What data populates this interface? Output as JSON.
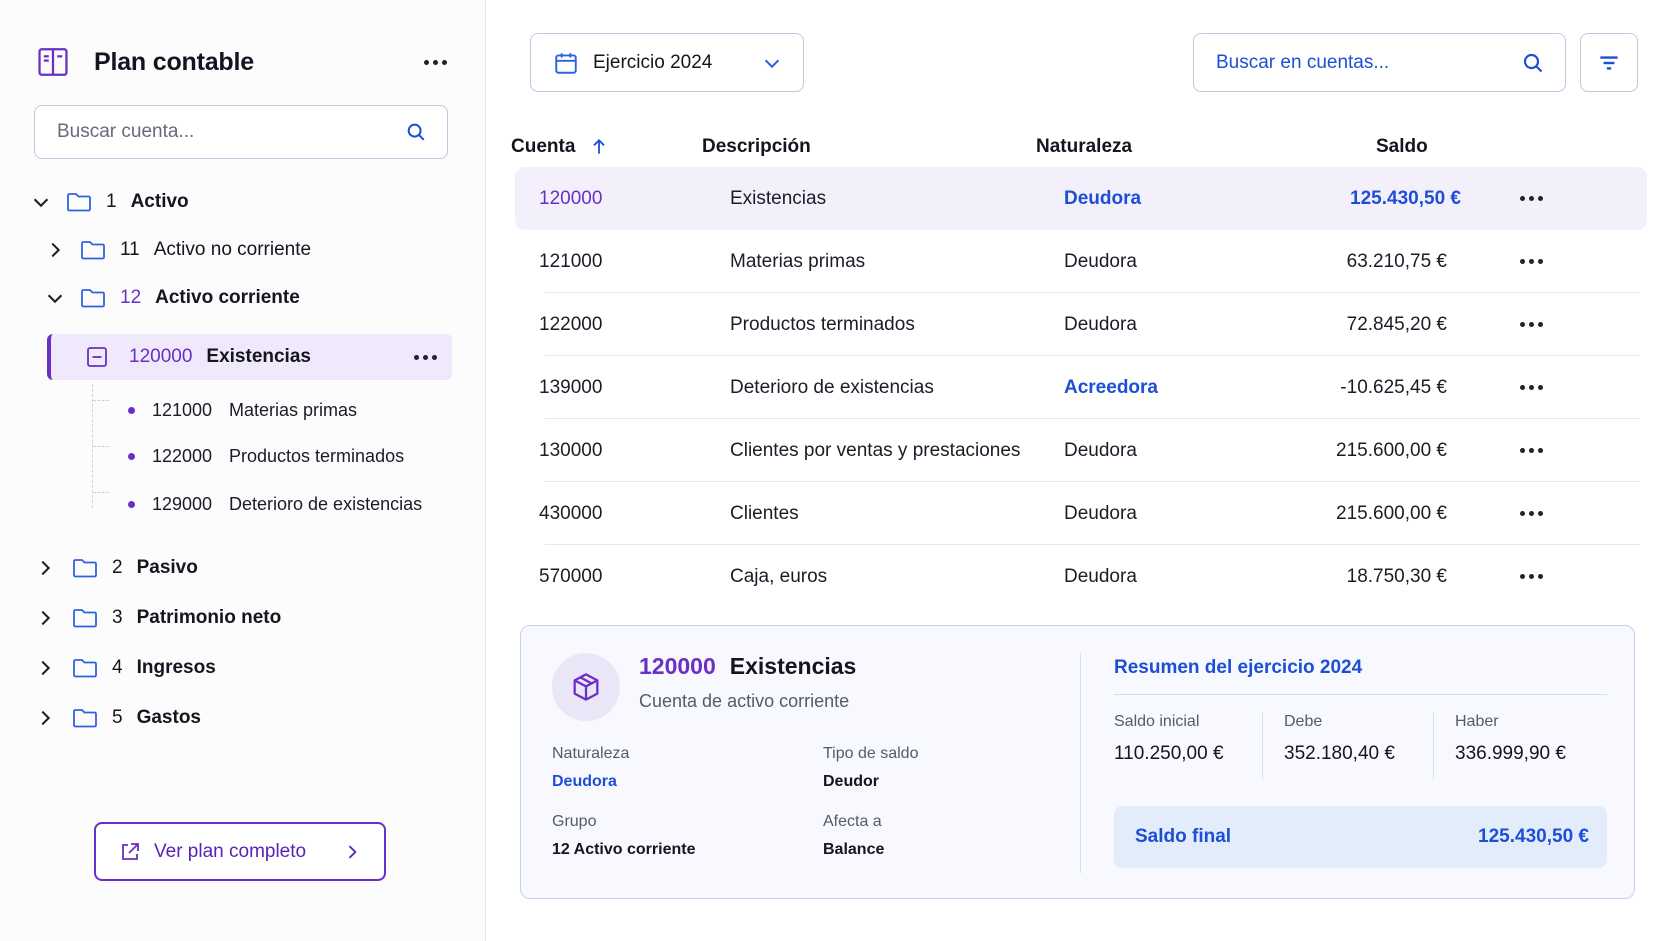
{
  "sidebar": {
    "title": "Plan contable",
    "search_placeholder": "Buscar cuenta...",
    "tree": [
      {
        "code": "1",
        "label": "Activo",
        "expanded": true
      },
      {
        "code": "11",
        "label": "Activo no corriente",
        "expanded": false
      },
      {
        "code": "12",
        "label": "Activo corriente",
        "expanded": true
      },
      {
        "code": "2",
        "label": "Pasivo",
        "expanded": false
      },
      {
        "code": "3",
        "label": "Patrimonio neto",
        "expanded": false
      },
      {
        "code": "4",
        "label": "Ingresos",
        "expanded": false
      },
      {
        "code": "5",
        "label": "Gastos",
        "expanded": false
      }
    ],
    "selected": {
      "code": "120000",
      "label": "Existencias"
    },
    "leaves": [
      {
        "code": "121000",
        "label": "Materias primas"
      },
      {
        "code": "122000",
        "label": "Productos terminados"
      },
      {
        "code": "129000",
        "label": "Deterioro de existencias"
      }
    ],
    "view_all_label": "Ver plan completo"
  },
  "toolbar": {
    "year_label": "Ejercicio 2024",
    "search_placeholder": "Buscar en cuentas..."
  },
  "table": {
    "columns": [
      "Cuenta",
      "Descripción",
      "Naturaleza",
      "Saldo"
    ],
    "rows": [
      {
        "cuenta": "120000",
        "descripcion": "Existencias",
        "naturaleza": "Deudora",
        "saldo": "125.430,50 €"
      },
      {
        "cuenta": "121000",
        "descripcion": "Materias primas",
        "naturaleza": "Deudora",
        "saldo": "63.210,75 €"
      },
      {
        "cuenta": "122000",
        "descripcion": "Productos terminados",
        "naturaleza": "Deudora",
        "saldo": "72.845,20 €"
      },
      {
        "cuenta": "139000",
        "descripcion": "Deterioro de existencias",
        "naturaleza": "Acreedora",
        "saldo": "-10.625,45 €"
      },
      {
        "cuenta": "130000",
        "descripcion": "Clientes por ventas y prestaciones",
        "naturaleza": "Deudora",
        "saldo": "215.600,00 €"
      },
      {
        "cuenta": "430000",
        "descripcion": "Clientes",
        "naturaleza": "Deudora",
        "saldo": "215.600,00 €"
      },
      {
        "cuenta": "570000",
        "descripcion": "Caja, euros",
        "naturaleza": "Deudora",
        "saldo": "18.750,30 €"
      }
    ]
  },
  "detail": {
    "code": "120000",
    "name": "Existencias",
    "subtitle": "Cuenta de activo corriente",
    "naturaleza_label": "Naturaleza",
    "naturaleza_value": "Deudora",
    "tipo_label": "Tipo de saldo",
    "tipo_value": "Deudor",
    "grupo_label": "Grupo",
    "grupo_value": "12 Activo corriente",
    "afecta_label": "Afecta a",
    "afecta_value": "Balance",
    "summary_title": "Resumen del ejercicio 2024",
    "saldo_inicial_label": "Saldo inicial",
    "saldo_inicial_value": "110.250,00 €",
    "debe_label": "Debe",
    "debe_value": "352.180,40 €",
    "haber_label": "Haber",
    "haber_value": "336.999,90 €",
    "saldo_final_label": "Saldo final",
    "saldo_final_value": "125.430,50 €"
  },
  "colors": {
    "accent_purple": "#6a2fc4",
    "accent_blue": "#1d4fd6",
    "selected_bg": "#efe9fb"
  }
}
